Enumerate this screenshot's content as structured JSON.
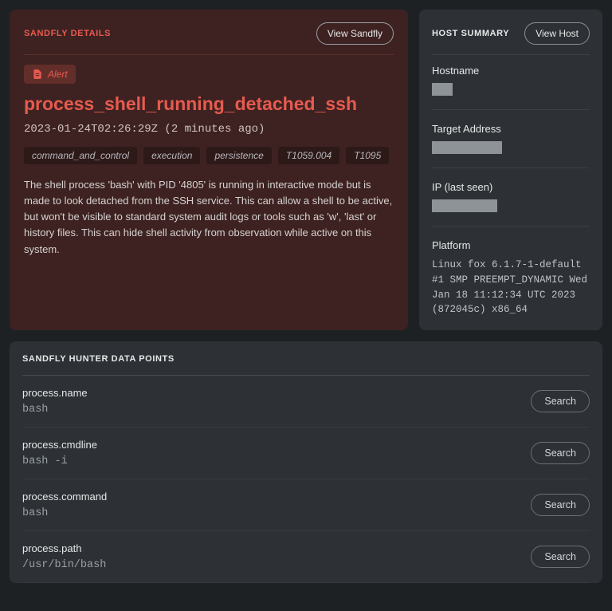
{
  "sandfly": {
    "header": "SANDFLY DETAILS",
    "view_btn": "View Sandfly",
    "alert_label": "Alert",
    "title": "process_shell_running_detached_ssh",
    "timestamp": "2023-01-24T02:26:29Z (2 minutes ago)",
    "tags": [
      "command_and_control",
      "execution",
      "persistence",
      "T1059.004",
      "T1095"
    ],
    "description": "The shell process 'bash' with PID '4805' is running in interactive mode but is made to look detached from the SSH service. This can allow a shell to be active, but won't be visible to standard system audit logs or tools such as 'w', 'last' or history files. This can hide shell activity from observation while active on this system."
  },
  "host": {
    "header": "HOST SUMMARY",
    "view_btn": "View Host",
    "hostname_label": "Hostname",
    "target_label": "Target Address",
    "ip_label": "IP (last seen)",
    "platform_label": "Platform",
    "platform_value": "Linux fox 6.1.7-1-default #1 SMP PREEMPT_DYNAMIC Wed Jan 18 11:12:34 UTC 2023 (872045c) x86_64"
  },
  "hunter": {
    "header": "SANDFLY HUNTER DATA POINTS",
    "search_label": "Search",
    "points": [
      {
        "key": "process.name",
        "val": "bash"
      },
      {
        "key": "process.cmdline",
        "val": "bash -i"
      },
      {
        "key": "process.command",
        "val": "bash"
      },
      {
        "key": "process.path",
        "val": "/usr/bin/bash"
      }
    ]
  }
}
